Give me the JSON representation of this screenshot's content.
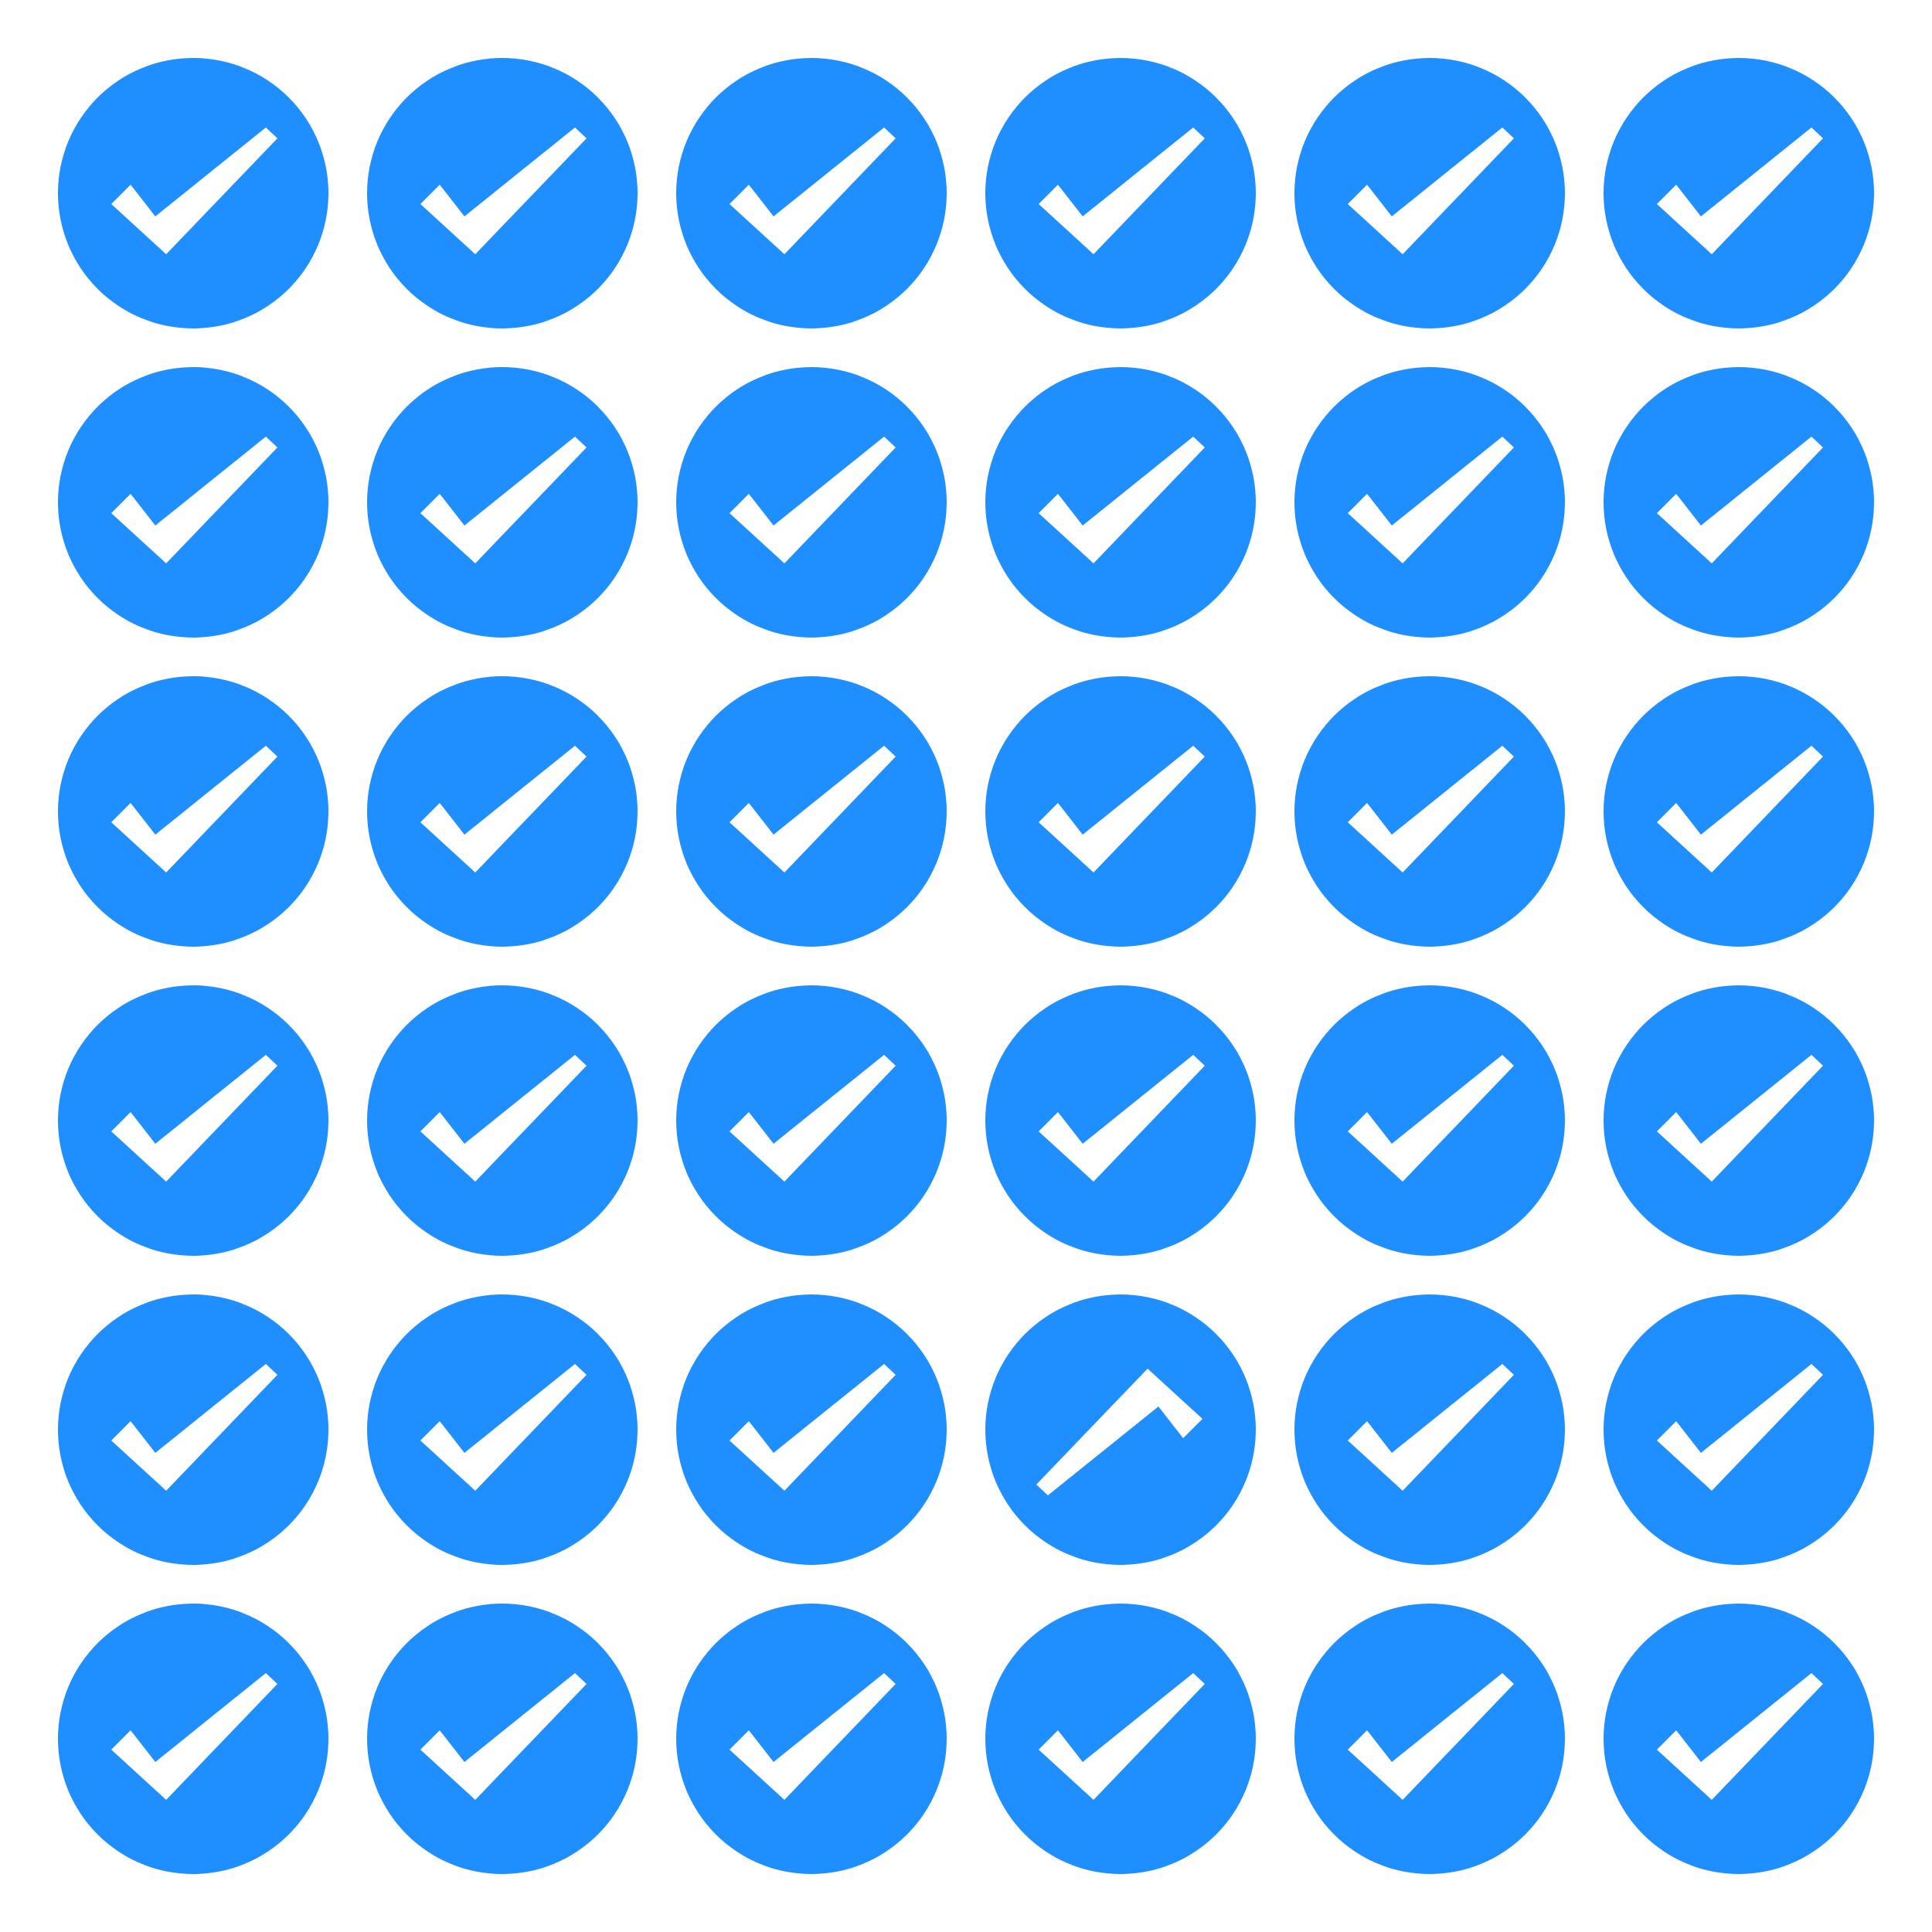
{
  "colors": {
    "background": "#ffffff",
    "badge_fill": "#1f8fff",
    "check_fill": "#ffffff"
  },
  "grid": {
    "rows": 6,
    "columns": 6
  },
  "badges": [
    {
      "row": 1,
      "column": 1,
      "icon": "checkmark-icon",
      "inverted": false
    },
    {
      "row": 1,
      "column": 2,
      "icon": "checkmark-icon",
      "inverted": false
    },
    {
      "row": 1,
      "column": 3,
      "icon": "checkmark-icon",
      "inverted": false
    },
    {
      "row": 1,
      "column": 4,
      "icon": "checkmark-icon",
      "inverted": false
    },
    {
      "row": 1,
      "column": 5,
      "icon": "checkmark-icon",
      "inverted": false
    },
    {
      "row": 1,
      "column": 6,
      "icon": "checkmark-icon",
      "inverted": false
    },
    {
      "row": 2,
      "column": 1,
      "icon": "checkmark-icon",
      "inverted": false
    },
    {
      "row": 2,
      "column": 2,
      "icon": "checkmark-icon",
      "inverted": false
    },
    {
      "row": 2,
      "column": 3,
      "icon": "checkmark-icon",
      "inverted": false
    },
    {
      "row": 2,
      "column": 4,
      "icon": "checkmark-icon",
      "inverted": false
    },
    {
      "row": 2,
      "column": 5,
      "icon": "checkmark-icon",
      "inverted": false
    },
    {
      "row": 2,
      "column": 6,
      "icon": "checkmark-icon",
      "inverted": false
    },
    {
      "row": 3,
      "column": 1,
      "icon": "checkmark-icon",
      "inverted": false
    },
    {
      "row": 3,
      "column": 2,
      "icon": "checkmark-icon",
      "inverted": false
    },
    {
      "row": 3,
      "column": 3,
      "icon": "checkmark-icon",
      "inverted": false
    },
    {
      "row": 3,
      "column": 4,
      "icon": "checkmark-icon",
      "inverted": false
    },
    {
      "row": 3,
      "column": 5,
      "icon": "checkmark-icon",
      "inverted": false
    },
    {
      "row": 3,
      "column": 6,
      "icon": "checkmark-icon",
      "inverted": false
    },
    {
      "row": 4,
      "column": 1,
      "icon": "checkmark-icon",
      "inverted": false
    },
    {
      "row": 4,
      "column": 2,
      "icon": "checkmark-icon",
      "inverted": false
    },
    {
      "row": 4,
      "column": 3,
      "icon": "checkmark-icon",
      "inverted": false
    },
    {
      "row": 4,
      "column": 4,
      "icon": "checkmark-icon",
      "inverted": false
    },
    {
      "row": 4,
      "column": 5,
      "icon": "checkmark-icon",
      "inverted": false
    },
    {
      "row": 4,
      "column": 6,
      "icon": "checkmark-icon",
      "inverted": false
    },
    {
      "row": 5,
      "column": 1,
      "icon": "checkmark-icon",
      "inverted": false
    },
    {
      "row": 5,
      "column": 2,
      "icon": "checkmark-icon",
      "inverted": false
    },
    {
      "row": 5,
      "column": 3,
      "icon": "checkmark-icon",
      "inverted": false
    },
    {
      "row": 5,
      "column": 4,
      "icon": "upside-down-checkmark-icon",
      "inverted": true
    },
    {
      "row": 5,
      "column": 5,
      "icon": "checkmark-icon",
      "inverted": false
    },
    {
      "row": 5,
      "column": 6,
      "icon": "checkmark-icon",
      "inverted": false
    },
    {
      "row": 6,
      "column": 1,
      "icon": "checkmark-icon",
      "inverted": false
    },
    {
      "row": 6,
      "column": 2,
      "icon": "checkmark-icon",
      "inverted": false
    },
    {
      "row": 6,
      "column": 3,
      "icon": "checkmark-icon",
      "inverted": false
    },
    {
      "row": 6,
      "column": 4,
      "icon": "checkmark-icon",
      "inverted": false
    },
    {
      "row": 6,
      "column": 5,
      "icon": "checkmark-icon",
      "inverted": false
    },
    {
      "row": 6,
      "column": 6,
      "icon": "checkmark-icon",
      "inverted": false
    }
  ]
}
